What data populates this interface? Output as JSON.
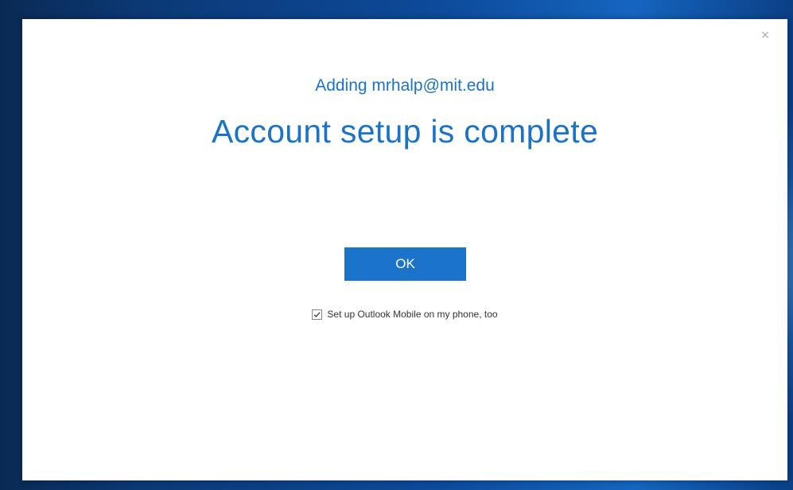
{
  "dialog": {
    "close_glyph": "×",
    "subtitle": "Adding mrhalp@mit.edu",
    "title": "Account setup is complete",
    "ok_label": "OK",
    "checkbox_label": "Set up Outlook Mobile on my phone, too",
    "checkbox_checked": true
  },
  "colors": {
    "accent": "#1a73c8",
    "button": "#1b74c9"
  }
}
